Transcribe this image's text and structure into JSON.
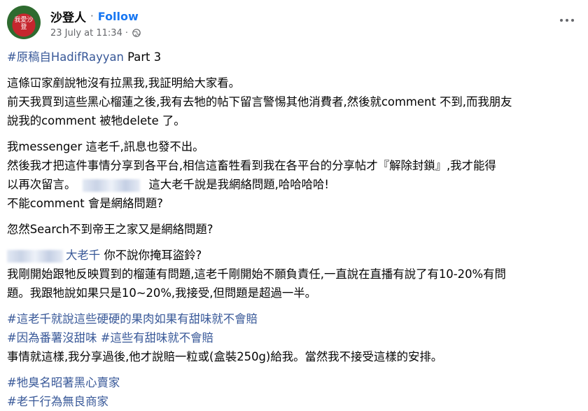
{
  "header": {
    "avatar_text": "我愛沙登",
    "page_name": "沙登人",
    "separator": "·",
    "follow_label": "Follow",
    "timestamp": "23 July at 11:34",
    "meta_separator": "·",
    "privacy_icon": "globe-icon",
    "more_icon": "more-options-icon"
  },
  "post": {
    "title_tag": "#原稿自HadifRayyan",
    "title_suffix": " Part 3",
    "p1_l1": "這條冚家剷說牠沒有拉黑我,我証明給大家看。",
    "p1_l2": "前天我買到這些黑心榴蓮之後,我有去牠的帖下留言警惕其他消費者,然後就comment 不到,而我朋友",
    "p1_l3": "說我的comment 被牠delete 了。",
    "p2_l1": "我messenger 這老千,訊息也發不出。",
    "p2_l2": "然後我才把這件事情分享到各平台,相信這畜牲看到我在各平台的分享帖才『解除封鎖』,我才能得",
    "p2_l3a": "以再次留言。",
    "p2_l3b": "這大老千說是我網絡問題,哈哈哈哈!",
    "p2_l4": "不能comment 會是網絡問題?",
    "p3_l1": "忽然Search不到帝王之家又是網絡問題?",
    "p4_mention": "大老千",
    "p4_l1b": " 你不說你掩耳盜鈴?",
    "p4_l2": "我剛開始跟牠反映買到的榴蓮有問題,這老千剛開始不願負責任,一直說在直播有說了有10-20%有問",
    "p4_l3": "題。我跟牠說如果只是10~20%,我接受,但問題是超過一半。",
    "tag1": "#這老千就說這些硬硬的果肉如果有甜味就不會賠",
    "tag2": "#因為番薯沒甜味",
    "tag3": "#這些有甜味就不會賠",
    "p5_l3": "事情就這樣,我分享過後,他才說賠一粒或(盒裝250g)給我。當然我不接受這樣的安排。",
    "tag4": "#牠臭名昭著黑心賣家",
    "tag5": "#老千行為無良商家"
  },
  "colors": {
    "link": "#385898",
    "follow": "#1877f2",
    "meta": "#65676b"
  }
}
